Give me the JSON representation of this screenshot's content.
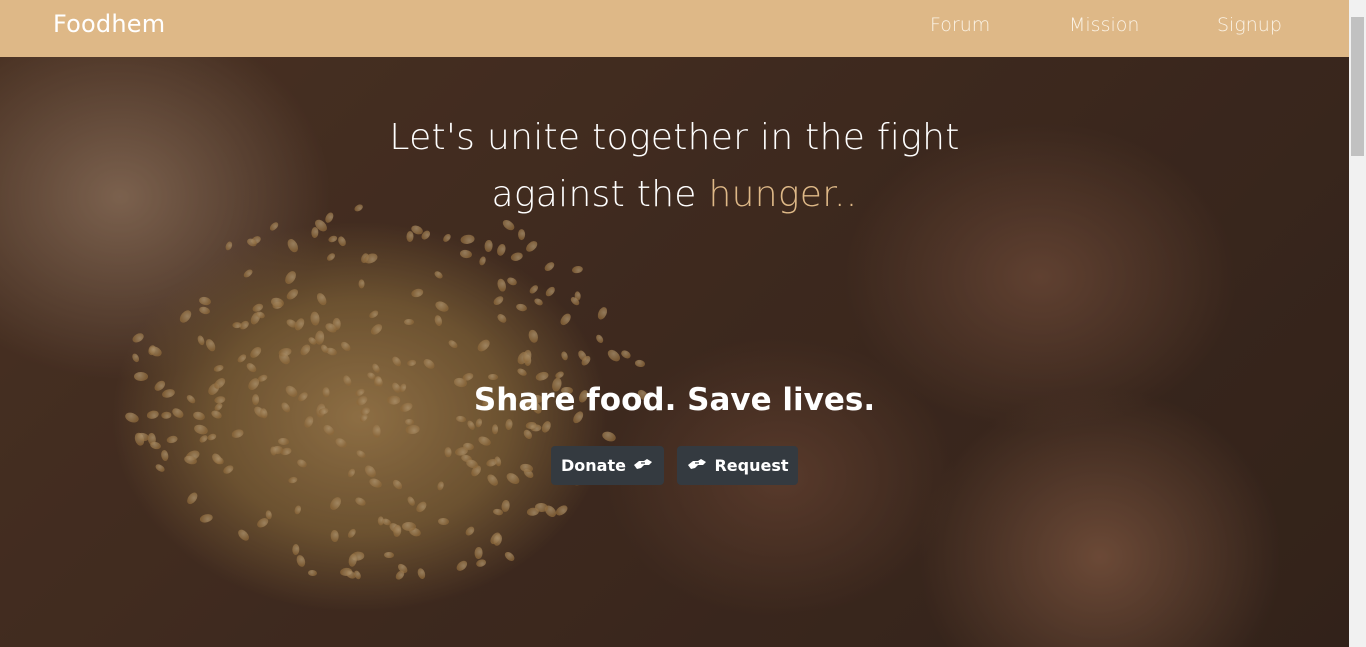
{
  "navbar": {
    "brand": "Foodhem",
    "links": [
      "Forum",
      "Mission",
      "Signup"
    ]
  },
  "hero": {
    "headline_line1": "Let's unite together in the fight",
    "headline_line2_prefix": "against the ",
    "headline_accent": "hunger..",
    "tagline": "Share food. Save lives.",
    "buttons": {
      "donate": "Donate",
      "request": "Request"
    }
  },
  "icons": {
    "donate": "hands-helping-icon",
    "request": "hands-helping-icon"
  },
  "colors": {
    "navbar_bg": "#deb887",
    "accent": "#deb887",
    "button_bg": "#343a40"
  }
}
